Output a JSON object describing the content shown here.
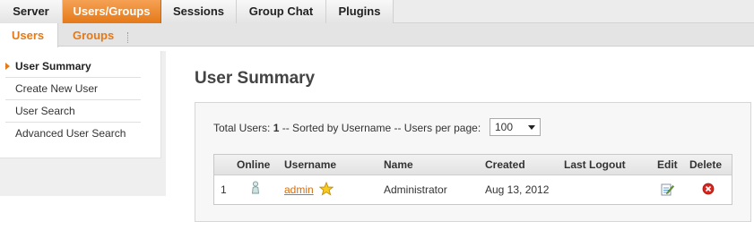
{
  "topnav": {
    "tabs": [
      {
        "label": "Server"
      },
      {
        "label": "Users/Groups"
      },
      {
        "label": "Sessions"
      },
      {
        "label": "Group Chat"
      },
      {
        "label": "Plugins"
      }
    ]
  },
  "subnav": {
    "tabs": [
      {
        "label": "Users"
      },
      {
        "label": "Groups"
      }
    ]
  },
  "sidebar": {
    "items": [
      {
        "label": "User Summary"
      },
      {
        "label": "Create New User"
      },
      {
        "label": "User Search"
      },
      {
        "label": "Advanced User Search"
      }
    ]
  },
  "main": {
    "title": "User Summary",
    "totals": {
      "prefix": "Total Users:",
      "count": "1",
      "sort_text": "-- Sorted by Username -- Users per page:",
      "per_page": "100"
    },
    "table": {
      "headers": {
        "online": "Online",
        "username": "Username",
        "name": "Name",
        "created": "Created",
        "last_logout": "Last Logout",
        "edit": "Edit",
        "delete": "Delete"
      },
      "rows": [
        {
          "index": "1",
          "username": "admin",
          "name": "Administrator",
          "created": "Aug 13, 2012",
          "last_logout": ""
        }
      ]
    }
  },
  "colors": {
    "accent": "#e57918",
    "link": "#d56d0c"
  },
  "icons": {
    "online": "user-offline-icon",
    "admin_badge": "star-icon",
    "edit": "edit-icon",
    "delete": "delete-icon"
  }
}
